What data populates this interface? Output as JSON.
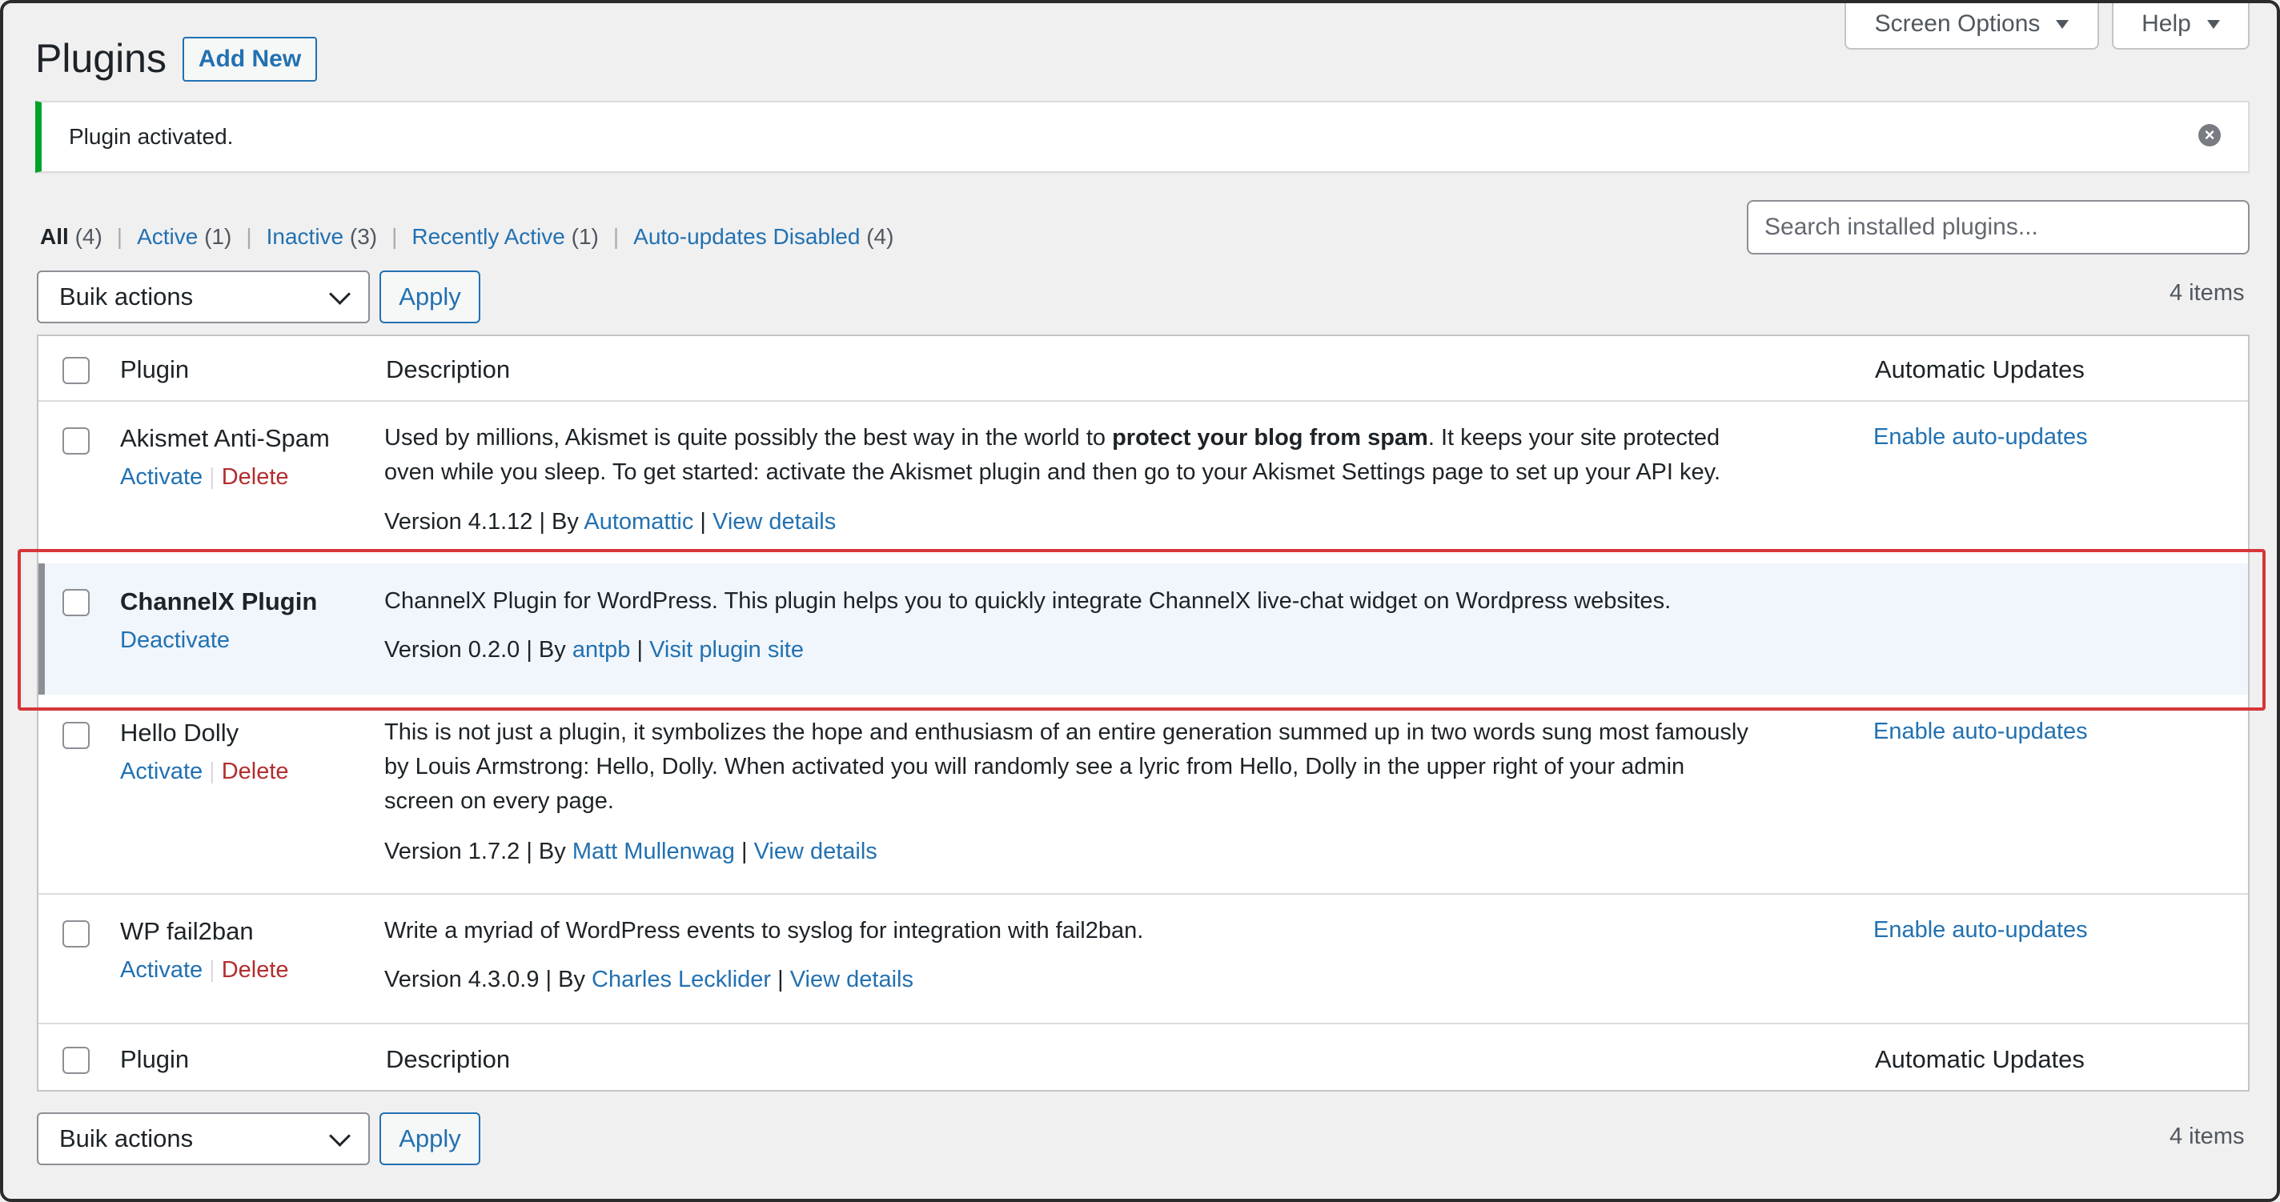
{
  "header": {
    "title": "Plugins",
    "add_new": "Add New",
    "screen_options": "Screen Options",
    "help": "Help"
  },
  "notice": {
    "text": "Plugin activated."
  },
  "filters": {
    "all": "All",
    "all_count": "(4)",
    "active": "Active",
    "active_count": "(1)",
    "inactive": "Inactive",
    "inactive_count": "(3)",
    "recent": "Recently Active",
    "recent_count": "(1)",
    "autoupdates": "Auto-updates Disabled",
    "autoupdates_count": "(4)",
    "separator": "|"
  },
  "search": {
    "placeholder": "Search installed plugins..."
  },
  "bulk": {
    "selected": "Buik actions",
    "apply": "Apply",
    "items": "4 items"
  },
  "bulk_bottom": {
    "selected": "Buik actions",
    "apply": "Apply",
    "items": "4 items"
  },
  "columns": {
    "plugin": "Plugin",
    "description": "Description",
    "auto": "Automatic Updates"
  },
  "plugins": [
    {
      "name": "Akismet Anti-Spam",
      "action1": "Activate",
      "action2": "Delete",
      "sep": "|",
      "desc_line1_pre": "Used by millions, Akismet is quite possibly the best way in the world to ",
      "desc_line1_bold": "protect your blog from spam",
      "desc_line1_post": ". It keeps your site protected",
      "desc_line2": "oven while you sleep. To get started: activate the Akismet plugin and then go to your Akismet Settings page to set up your API key.",
      "version": "Version 4.1.12 | By ",
      "author": "Automattic",
      "meta_sep": " | ",
      "details": "View details",
      "auto": "Enable auto-updates"
    },
    {
      "name": "ChannelX Plugin",
      "action1": "Deactivate",
      "desc_line1": "ChannelX Plugin for WordPress. This plugin helps you to quickly integrate ChannelX live-chat widget on Wordpress websites.",
      "version": "Version 0.2.0 | By ",
      "author": "antpb",
      "meta_sep": " | ",
      "details": "Visit plugin site"
    },
    {
      "name": "Hello Dolly",
      "action1": "Activate",
      "action2": "Delete",
      "sep": "|",
      "desc_line1": "This is not just a plugin, it symbolizes the hope and enthusiasm of an entire generation summed up in two words sung most famously",
      "desc_line2": "by Louis Armstrong: Hello, Dolly. When activated you will randomly see a lyric from Hello, Dolly in the upper right of your admin",
      "desc_line3": "screen on every page.",
      "version": "Version 1.7.2 | By ",
      "author": "Matt Mullenwag",
      "meta_sep": " | ",
      "details": "View details",
      "auto": "Enable auto-updates"
    },
    {
      "name": "WP fail2ban",
      "action1": "Activate",
      "action2": "Delete",
      "sep": "|",
      "desc_line1": "Write a myriad of WordPress events to syslog for integration with fail2ban.",
      "version": "Version 4.3.0.9 | By ",
      "author": "Charles Lecklider",
      "meta_sep": " | ",
      "details": "View details",
      "auto": "Enable auto-updates"
    }
  ]
}
